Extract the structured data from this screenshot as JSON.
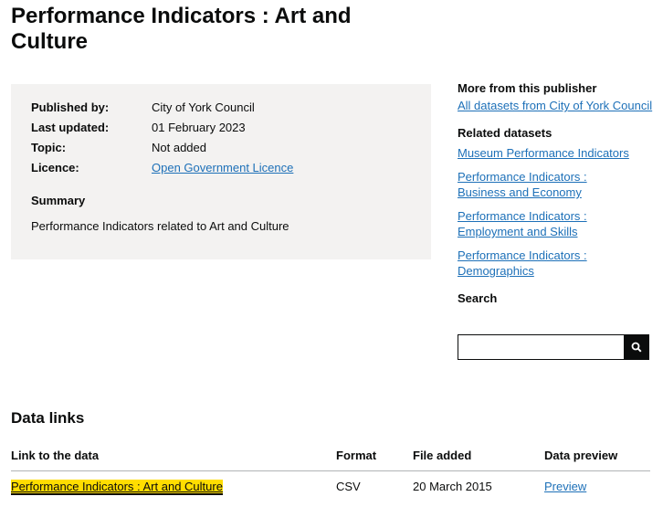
{
  "page": {
    "title": "Performance Indicators : Art and Culture"
  },
  "metadata": {
    "published_by_label": "Published by:",
    "published_by": "City of York Council",
    "last_updated_label": "Last updated:",
    "last_updated": "01 February 2023",
    "topic_label": "Topic:",
    "topic": "Not added",
    "licence_label": "Licence:",
    "licence": "Open Government Licence",
    "summary_heading": "Summary",
    "summary_text": "Performance Indicators related to Art and Culture"
  },
  "sidebar": {
    "publisher_heading": "More from this publisher",
    "publisher_link": "All datasets from City of York Council",
    "related_heading": "Related datasets",
    "related": [
      "Museum Performance Indicators",
      "Performance Indicators : Business and Economy",
      "Performance Indicators : Employment and Skills",
      "Performance Indicators : Demographics"
    ],
    "search_heading": "Search"
  },
  "data_links": {
    "heading": "Data links",
    "columns": [
      "Link to the data",
      "Format",
      "File added",
      "Data preview"
    ],
    "rows": [
      {
        "link": "Performance Indicators : Art and Culture",
        "format": "CSV",
        "added": "20 March 2015",
        "preview": "Preview"
      }
    ]
  },
  "colors": {
    "link": "#1d70b8",
    "panel": "#f3f2f1",
    "focus_highlight": "#ffdd00"
  },
  "icons": {
    "search": "search-icon"
  }
}
